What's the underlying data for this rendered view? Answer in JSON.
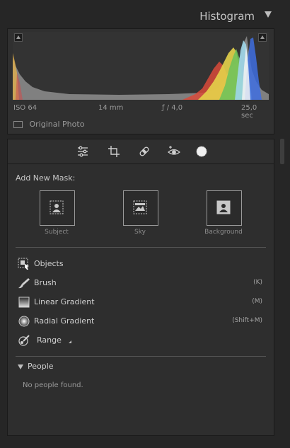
{
  "histogram": {
    "title": "Histogram",
    "exif": {
      "iso": "ISO 64",
      "focal": "14 mm",
      "aperture": "ƒ / 4,0",
      "shutter": "25,0 sec"
    },
    "original_photo_label": "Original Photo"
  },
  "masking": {
    "add_title": "Add New Mask:",
    "presets": [
      {
        "label": "Subject"
      },
      {
        "label": "Sky"
      },
      {
        "label": "Background"
      }
    ],
    "tools": [
      {
        "label": "Objects",
        "shortcut": ""
      },
      {
        "label": "Brush",
        "shortcut": "(K)"
      },
      {
        "label": "Linear Gradient",
        "shortcut": "(M)"
      },
      {
        "label": "Radial Gradient",
        "shortcut": "(Shift+M)"
      },
      {
        "label": "Range",
        "shortcut": ""
      }
    ],
    "people": {
      "title": "People",
      "empty": "No people found."
    }
  }
}
